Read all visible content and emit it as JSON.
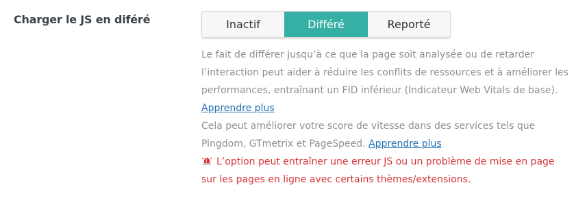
{
  "setting": {
    "label": "Charger le JS en diféré"
  },
  "switcher": {
    "options": [
      "Inactif",
      "Différé",
      "Reporté"
    ],
    "selected": "Différé",
    "active_color": "#36b0a5"
  },
  "description": {
    "text1": "Le fait de différer jusqu’à ce que la page soit analysée ou de retarder l’interaction peut aider à réduire les conflits de ressources et à améliorer les performances, entraînant un FID inférieur (Indicateur Web Vitals de base).",
    "link1": "Apprendre plus",
    "text2": "Cela peut améliorer votre score de vitesse dans des services tels que Pingdom, GTmetrix et PageSpeed.",
    "link2": "Apprendre plus",
    "warning_icon": "warning-siren-icon",
    "warning": "L’option peut entraîner une erreur JS ou un problème de mise en page sur les pages en ligne avec certains thèmes/extensions.",
    "text_color": "#8c8f94",
    "link_color": "#2271b1",
    "warning_color": "#d63638"
  }
}
